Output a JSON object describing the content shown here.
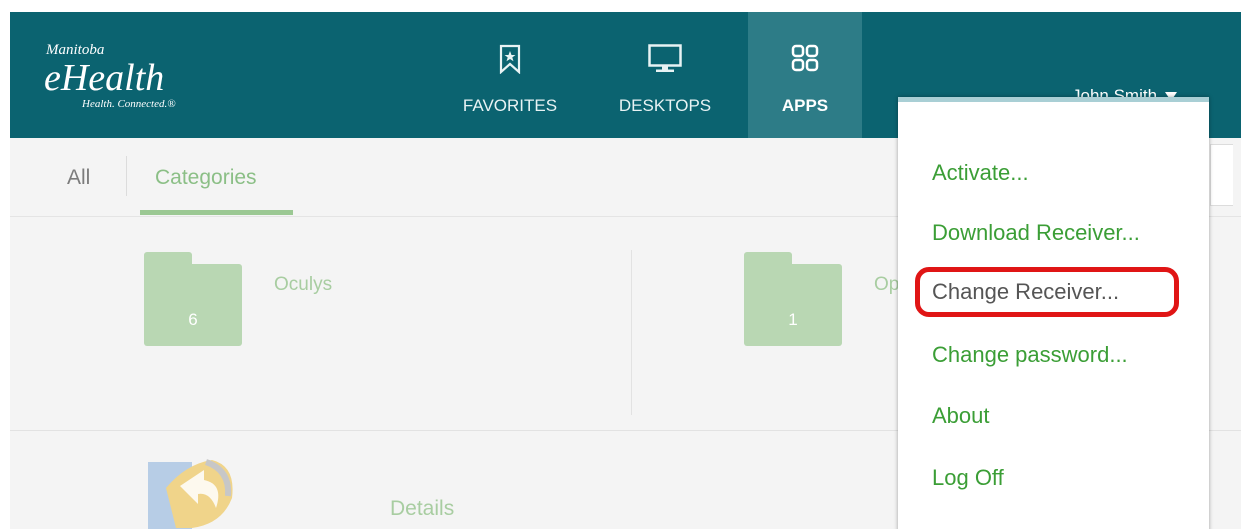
{
  "header": {
    "logo": {
      "top": "Manitoba",
      "main": "eHealth",
      "tagline": "Health. Connected.®"
    },
    "nav": [
      {
        "label": "FAVORITES",
        "icon": "bookmark-star-icon"
      },
      {
        "label": "DESKTOPS",
        "icon": "monitor-icon"
      },
      {
        "label": "APPS",
        "icon": "grid-icon",
        "active": true
      }
    ],
    "user": {
      "name": "John Smith",
      "icon": "caret-down-icon"
    }
  },
  "tabs": {
    "all": "All",
    "categories": "Categories",
    "active": "Categories"
  },
  "categories": [
    {
      "name": "Oculys",
      "count": "6"
    },
    {
      "name": "Op",
      "count": "1"
    }
  ],
  "app": {
    "label": "Details"
  },
  "user_menu": {
    "items": [
      {
        "label": "Activate..."
      },
      {
        "label": "Download Receiver..."
      },
      {
        "label": "Change Receiver...",
        "highlighted": true
      },
      {
        "label": "Change password..."
      },
      {
        "label": "About"
      },
      {
        "label": "Log Off"
      }
    ]
  },
  "colors": {
    "header": "#0b6370",
    "active_nav": "#2d7c87",
    "accent_green": "#3b9e36",
    "highlight_ring": "#e01515"
  }
}
